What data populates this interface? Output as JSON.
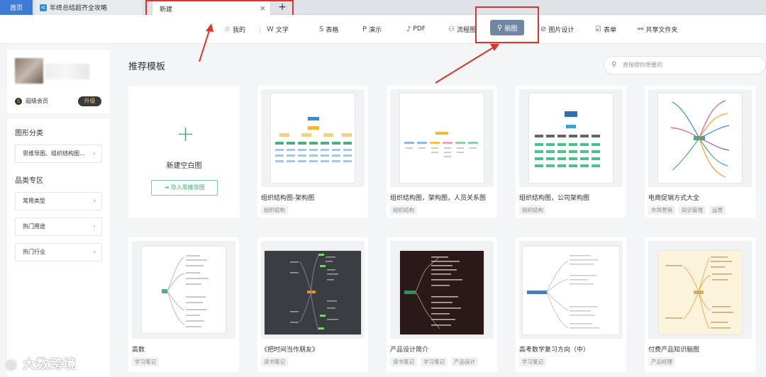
{
  "tabs": {
    "home": "首页",
    "doc": "年终总结超齐全攻略",
    "active": "新建",
    "close": "×",
    "new": "+"
  },
  "toolbar": [
    {
      "icon": "☆",
      "label": "我的"
    },
    {
      "icon": "W",
      "label": "文字"
    },
    {
      "icon": "S",
      "label": "表格"
    },
    {
      "icon": "P",
      "label": "演示"
    },
    {
      "icon": "♪",
      "label": "PDF"
    },
    {
      "icon": "⚇",
      "label": "流程图"
    },
    {
      "icon": "⚲",
      "label": "脑图"
    },
    {
      "icon": "⊘",
      "label": "图片设计"
    },
    {
      "icon": "☑",
      "label": "表单"
    },
    {
      "icon": "⚯",
      "label": "共享文件夹"
    }
  ],
  "user": {
    "vip": "超级会员",
    "upgrade": "升级"
  },
  "sidebar": {
    "graph_title": "图形分类",
    "graph_item": "思维导图、组织结构图...",
    "zone_title": "品类专区",
    "zone_items": [
      "常用类型",
      "热门用途",
      "热门行业"
    ]
  },
  "main": {
    "title": "推荐模板",
    "search_placeholder": "直接搜你想要的",
    "blank_label": "新建空白图",
    "import_label": "导入思维导图",
    "cards": [
      {
        "name": "组织结构图-架构图",
        "tags": [
          "组织结构"
        ]
      },
      {
        "name": "组织结构图，架构图，人员关系图",
        "tags": [
          "组织结构"
        ]
      },
      {
        "name": "组织结构图，公司架构图",
        "tags": [
          "组织结构"
        ]
      },
      {
        "name": "电商促销方式大全",
        "tags": [
          "市场营销",
          "知识管理",
          "运营"
        ]
      },
      {
        "name": "高数",
        "tags": [
          "学习笔记"
        ]
      },
      {
        "name": "《把时间当作朋友》",
        "tags": [
          "读书笔记"
        ]
      },
      {
        "name": "产品设计简介",
        "tags": [
          "读书笔记",
          "学习笔记",
          "产品设计"
        ]
      },
      {
        "name": "高考数学复习方向（中）",
        "tags": [
          "学习笔记"
        ]
      },
      {
        "name": "付费产品知识脑图",
        "tags": [
          "产品经理"
        ]
      }
    ]
  },
  "watermark": "大数跨境"
}
